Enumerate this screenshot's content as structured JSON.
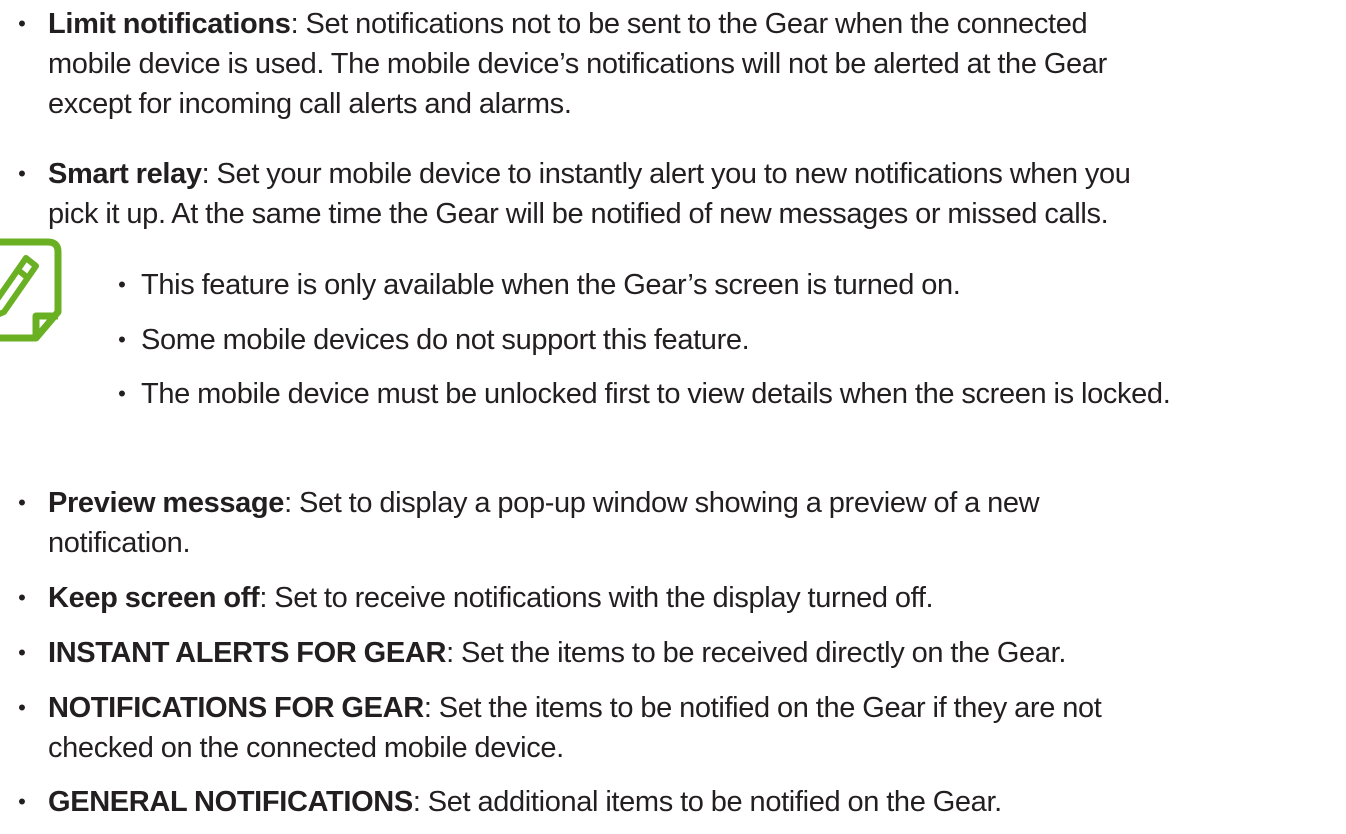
{
  "items_top": [
    {
      "term": "Limit notifications",
      "lines": [
        ": Set notifications not to be sent to the Gear when the connected",
        "mobile device is used. The mobile device’s notifications will not be alerted at the Gear",
        "except for incoming call alerts and alarms."
      ]
    },
    {
      "term": "Smart relay",
      "lines": [
        ": Set your mobile device to instantly alert you to new notifications when you",
        "pick it up. At the same time the Gear will be notified of new messages or missed calls."
      ]
    }
  ],
  "note": {
    "icon": "note-pencil-icon",
    "icon_color": "#6ab023",
    "items": [
      "This feature is only available when the Gear’s screen is turned on.",
      "Some mobile devices do not support this feature.",
      "The mobile device must be unlocked first to view details when the screen is locked."
    ]
  },
  "items_bottom": [
    {
      "term": "Preview message",
      "lines": [
        ": Set to display a pop-up window showing a preview of a new",
        "notification."
      ]
    },
    {
      "term": "Keep screen off",
      "lines": [
        ": Set to receive notifications with the display turned off."
      ]
    },
    {
      "term": "INSTANT ALERTS FOR GEAR",
      "lines": [
        ": Set the items to be received directly on the Gear."
      ]
    },
    {
      "term": "NOTIFICATIONS FOR GEAR",
      "lines": [
        ": Set the items to be notified on the Gear if they are not",
        "checked on the connected mobile device."
      ]
    },
    {
      "term": "GENERAL NOTIFICATIONS",
      "lines": [
        ": Set additional items to be notified on the Gear."
      ]
    }
  ],
  "bullet": "•"
}
